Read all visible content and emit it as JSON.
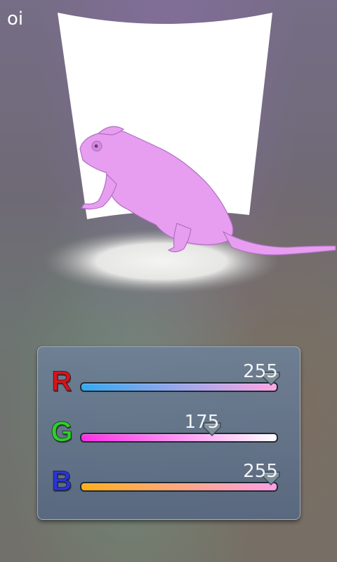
{
  "app": {
    "title": "oi"
  },
  "colors": {
    "tint": "#e79ef0",
    "panel": "#6b7f98",
    "red_letter": "#d8141c",
    "green_letter": "#2fcf2a",
    "blue_letter": "#2a35d6"
  },
  "sliders": [
    {
      "channel": "R",
      "value": "255",
      "level": 1.0,
      "track_gradient": [
        "#35a8f0",
        "#ffa6e6"
      ],
      "letter_color": "#d8141c"
    },
    {
      "channel": "G",
      "value": "175",
      "level": 0.686,
      "track_gradient": [
        "#ff2ee6",
        "#ffffff"
      ],
      "letter_color": "#2fcf2a"
    },
    {
      "channel": "B",
      "value": "255",
      "level": 1.0,
      "track_gradient": [
        "#ffae18",
        "#ff9ee6"
      ],
      "letter_color": "#2a35d6"
    }
  ]
}
